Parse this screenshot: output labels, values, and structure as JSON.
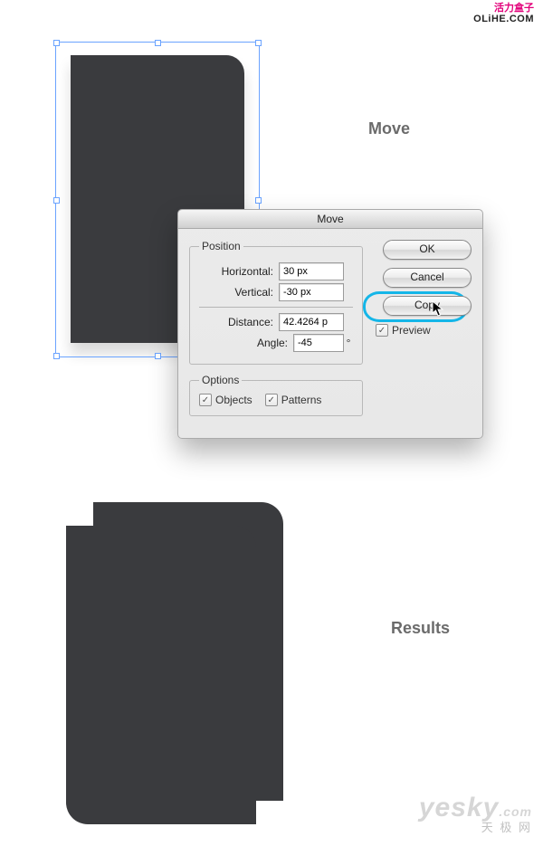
{
  "watermark_top": {
    "line1": "活力盒子",
    "line2": "OLiHE.COM"
  },
  "labels": {
    "move": "Move",
    "results": "Results"
  },
  "dialog": {
    "title": "Move",
    "position": {
      "legend": "Position",
      "horizontal_label": "Horizontal:",
      "horizontal_value": "30 px",
      "vertical_label": "Vertical:",
      "vertical_value": "-30 px",
      "distance_label": "Distance:",
      "distance_value": "42.4264 p",
      "angle_label": "Angle:",
      "angle_value": "-45",
      "deg": "°"
    },
    "options": {
      "legend": "Options",
      "objects": "Objects",
      "patterns": "Patterns"
    },
    "buttons": {
      "ok": "OK",
      "cancel": "Cancel",
      "copy": "Copy"
    },
    "preview": "Preview",
    "check": "✓"
  },
  "yesky": {
    "logo": "yesky",
    "com": ".com",
    "cn": "天 极 网"
  }
}
